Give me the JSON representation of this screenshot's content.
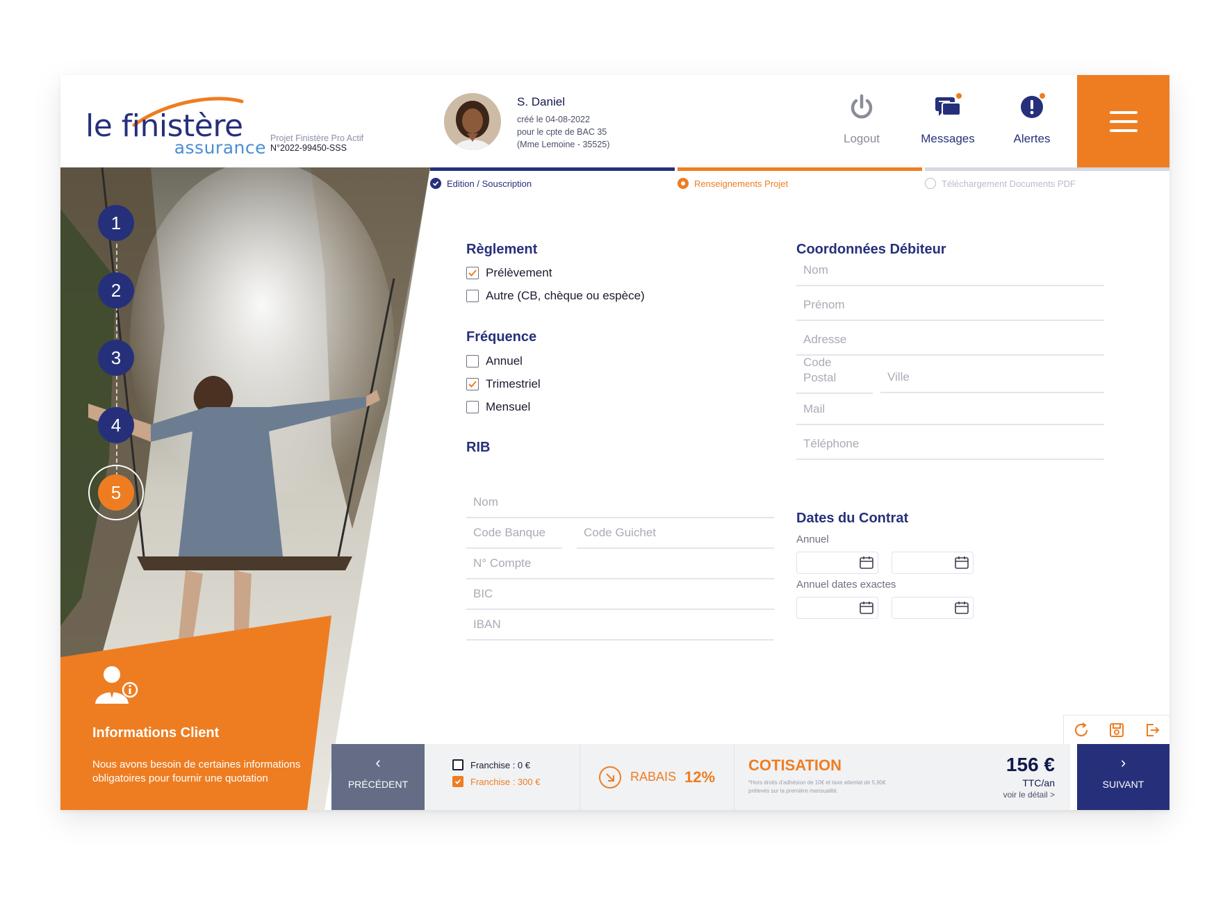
{
  "colors": {
    "navy": "#26307a",
    "orange": "#ee7d22",
    "grey": "#646d85"
  },
  "brand": {
    "name_main": "le finistère",
    "name_sub": "assurance"
  },
  "project": {
    "label": "Projet Finistère Pro Actif",
    "number": "N°2022-99450-SSS"
  },
  "user": {
    "name": "S. Daniel",
    "created": "créé le 04-08-2022",
    "account": "pour le cpte de BAC 35",
    "client": "(Mme Lemoine - 35525)"
  },
  "header_actions": [
    {
      "label": "Logout",
      "icon": "power-icon"
    },
    {
      "label": "Messages",
      "icon": "chat-icon"
    },
    {
      "label": "Alertes",
      "icon": "alert-icon"
    }
  ],
  "steps_progress": [
    {
      "label": "Edition / Souscription",
      "state": "done"
    },
    {
      "label": "Renseignements Projet",
      "state": "current"
    },
    {
      "label": "Téléchargement Documents PDF",
      "state": "todo"
    }
  ],
  "side_steps": [
    "1",
    "2",
    "3",
    "4",
    "5"
  ],
  "side_active_step": "5",
  "info_client": {
    "title": "Informations Client",
    "text": "Nous avons besoin de certaines informations obligatoires pour fournir une quotation"
  },
  "reglement": {
    "title": "Règlement",
    "options": [
      {
        "label": "Prélèvement",
        "checked": true
      },
      {
        "label": "Autre (CB, chèque ou espèce)",
        "checked": false
      }
    ]
  },
  "frequence": {
    "title": "Fréquence",
    "options": [
      {
        "label": "Annuel",
        "checked": false
      },
      {
        "label": "Trimestriel",
        "checked": true
      },
      {
        "label": "Mensuel",
        "checked": false
      }
    ]
  },
  "rib": {
    "title": "RIB",
    "nom": "Nom",
    "code_banque": "Code Banque",
    "code_guichet": "Code Guichet",
    "compte": "N° Compte",
    "bic": "BIC",
    "iban": "IBAN"
  },
  "debiteur": {
    "title": "Coordonnées Débiteur",
    "nom": "Nom",
    "prenom": "Prénom",
    "adresse": "Adresse",
    "code_postal": "Code Postal",
    "ville": "Ville",
    "mail": "Mail",
    "telephone": "Téléphone"
  },
  "dates": {
    "title": "Dates du Contrat",
    "annuel": "Annuel",
    "annuel_exactes": "Annuel dates exactes"
  },
  "bottom": {
    "prev": "PRÉCÉDENT",
    "next": "SUIVANT",
    "franchise_1": "Franchise : 0 €",
    "franchise_2": "Franchise : 300 €",
    "rabais_label": "RABAIS",
    "rabais_value": "12%",
    "cotisation": "COTISATION",
    "cotisation_note": "*Hors droits d'adhésion de 10€ et taxe attentat de 5,90€ prélevés sur la première mensualité.",
    "price": "156 €",
    "price_unit": "TTC/an",
    "detail": "voir le détail >"
  }
}
